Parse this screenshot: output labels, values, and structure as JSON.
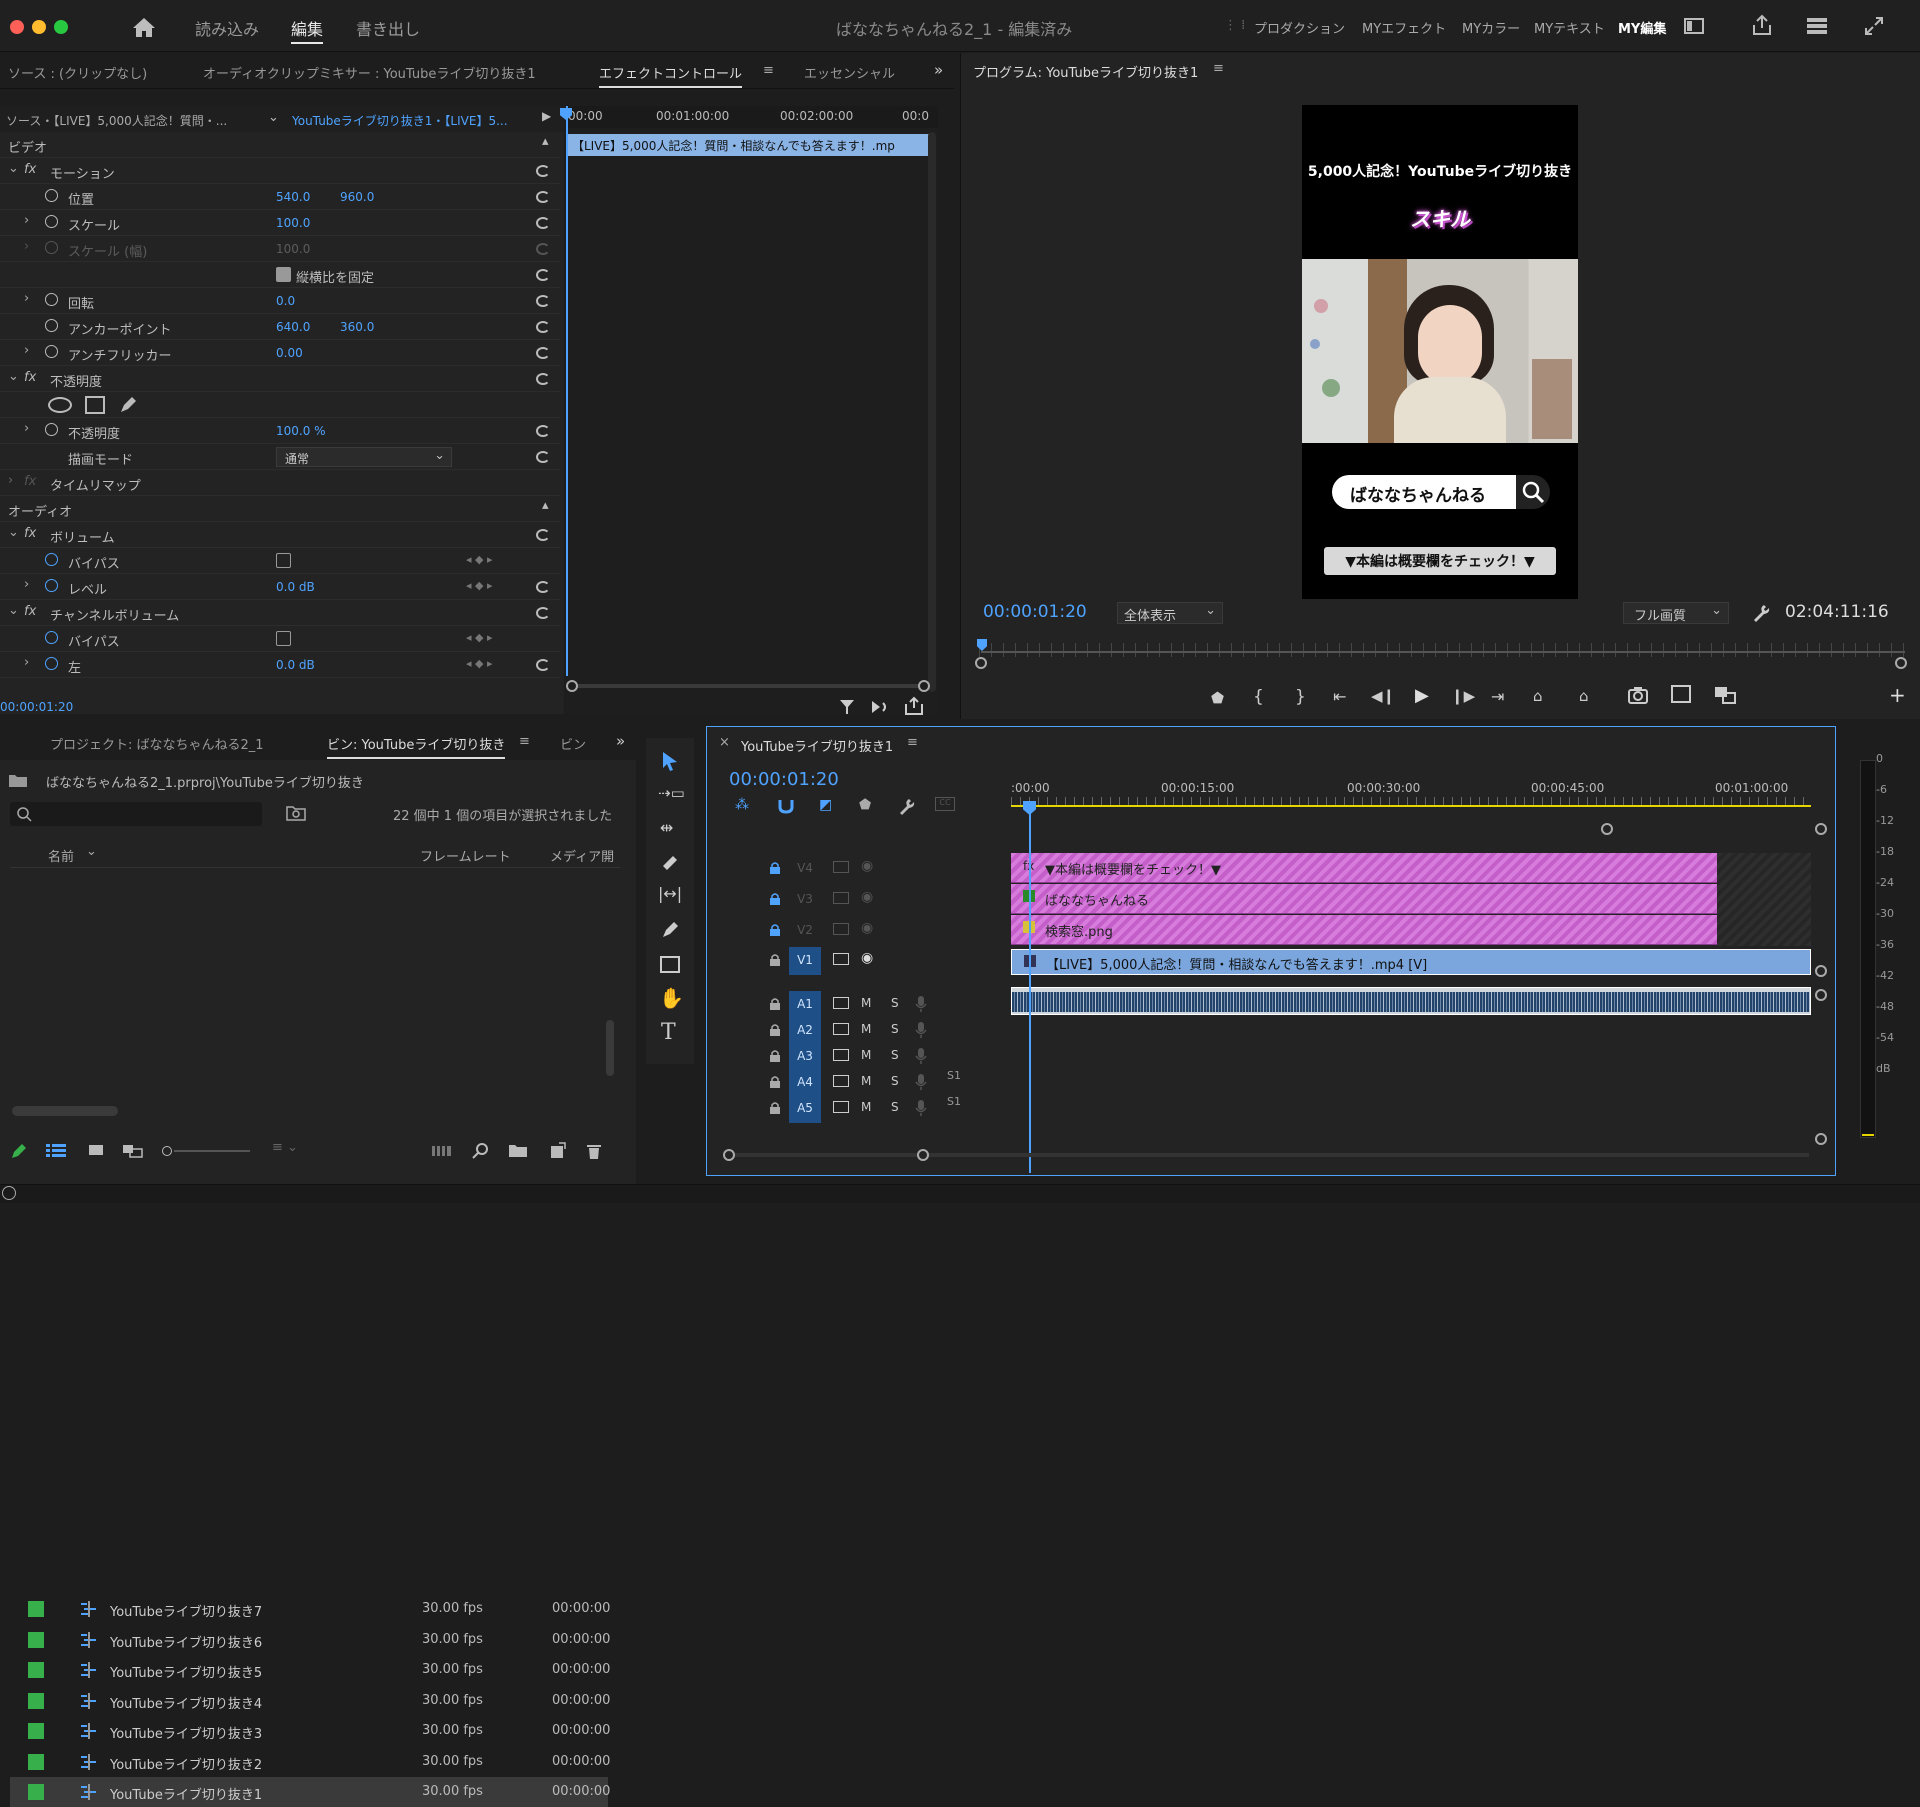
{
  "window": {
    "title": "ばななちゃんねる2_1 - 編集済み",
    "workspaces": [
      "読み込み",
      "編集",
      "書き出し"
    ],
    "active_workspace": "編集",
    "right_workspaces": [
      "プロダクション",
      "MYエフェクト",
      "MYカラー",
      "MYテキスト",
      "MY編集"
    ]
  },
  "source_tabs": {
    "source": "ソース : (クリップなし)",
    "audio_mixer": "オーディオクリップミキサー : YouTubeライブ切り抜き1",
    "effect_controls": "エフェクトコントロール",
    "essential": "エッセンシャル"
  },
  "effect_controls": {
    "source_label": "ソース・【LIVE】5,000人記念！質問・...",
    "sequence_label": "YouTubeライブ切り抜き1・【LIVE】5...",
    "ruler": [
      "00:00",
      "00:01:00:00",
      "00:02:00:00",
      "00:0"
    ],
    "clip_name": "【LIVE】5,000人記念！質問・相談なんでも答えます！.mp",
    "video_header": "ビデオ",
    "audio_header": "オーディオ",
    "motion": "モーション",
    "position_label": "位置",
    "position_x": "540.0",
    "position_y": "960.0",
    "scale_label": "スケール",
    "scale_value": "100.0",
    "scale_width_label": "スケール (幅)",
    "scale_width_value": "100.0",
    "uniform_scale_label": "縦横比を固定",
    "rotation_label": "回転",
    "rotation_value": "0.0",
    "anchor_label": "アンカーポイント",
    "anchor_x": "640.0",
    "anchor_y": "360.0",
    "antiflicker_label": "アンチフリッカー",
    "antiflicker_value": "0.00",
    "opacity_group": "不透明度",
    "opacity_label": "不透明度",
    "opacity_value": "100.0 %",
    "blend_label": "描画モード",
    "blend_value": "通常",
    "time_remap": "タイムリマップ",
    "volume_group": "ボリューム",
    "bypass_label": "バイパス",
    "level_label": "レベル",
    "level_value": "0.0 dB",
    "channel_volume_group": "チャンネルボリューム",
    "bypass2_label": "バイパス",
    "left_label": "左",
    "left_value": "0.0 dB",
    "timecode": "00:00:01:20"
  },
  "program": {
    "title": "プログラム: YouTubeライブ切り抜き1",
    "video_title": "5,000人記念！YouTubeライブ切り抜き",
    "skill": "スキル",
    "search_text": "ばななちゃんねる",
    "check_text": "▼本編は概要欄をチェック！▼",
    "timecode": "00:00:01:20",
    "fit": "全体表示",
    "quality": "フル画質",
    "duration": "02:04:11:16"
  },
  "project": {
    "tab_project": "プロジェクト: ばななちゃんねる2_1",
    "tab_bin": "ビン: YouTubeライブ切り抜き",
    "tab_more": "ビン",
    "path": "ばななちゃんねる2_1.prproj\\YouTubeライブ切り抜き",
    "selection_info": "22 個中 1 個の項目が選択されました",
    "col_name": "名前",
    "col_fps": "フレームレート",
    "col_media": "メディア開",
    "items": [
      {
        "name": "YouTubeライブ切り抜き7",
        "fps": "30.00 fps",
        "start": "00:00:00"
      },
      {
        "name": "YouTubeライブ切り抜き6",
        "fps": "30.00 fps",
        "start": "00:00:00"
      },
      {
        "name": "YouTubeライブ切り抜き5",
        "fps": "30.00 fps",
        "start": "00:00:00"
      },
      {
        "name": "YouTubeライブ切り抜き4",
        "fps": "30.00 fps",
        "start": "00:00:00"
      },
      {
        "name": "YouTubeライブ切り抜き3",
        "fps": "30.00 fps",
        "start": "00:00:00"
      },
      {
        "name": "YouTubeライブ切り抜き2",
        "fps": "30.00 fps",
        "start": "00:00:00"
      },
      {
        "name": "YouTubeライブ切り抜き1",
        "fps": "30.00 fps",
        "start": "00:00:00"
      }
    ]
  },
  "timeline": {
    "tab": "YouTubeライブ切り抜き1",
    "timecode": "00:00:01:20",
    "ruler": [
      ":00:00",
      "00:00:15:00",
      "00:00:30:00",
      "00:00:45:00",
      "00:01:00:00"
    ],
    "video_tracks": [
      "V4",
      "V3",
      "V2",
      "V1"
    ],
    "audio_tracks": [
      "A1",
      "A2",
      "A3",
      "A4",
      "A5"
    ],
    "clip_v4": "▼本編は概要欄をチェック！▼",
    "clip_v3": "ばななちゃんねる",
    "clip_v2": "検索窓.png",
    "clip_v1": "【LIVE】5,000人記念！質問・相談なんでも答えます！.mp4 [V]",
    "m_label": "M",
    "s_label": "S",
    "s1_label": "S1"
  },
  "meter": {
    "ticks": [
      "0",
      "-6",
      "-12",
      "-18",
      "-24",
      "-30",
      "-36",
      "-42",
      "-48",
      "-54",
      "dB"
    ]
  },
  "colors": {
    "accent_blue": "#4fa3ff",
    "clip_pink": "#d77bdc",
    "clip_blue": "#7aa6dd",
    "swatch_green": "#37b04c"
  }
}
